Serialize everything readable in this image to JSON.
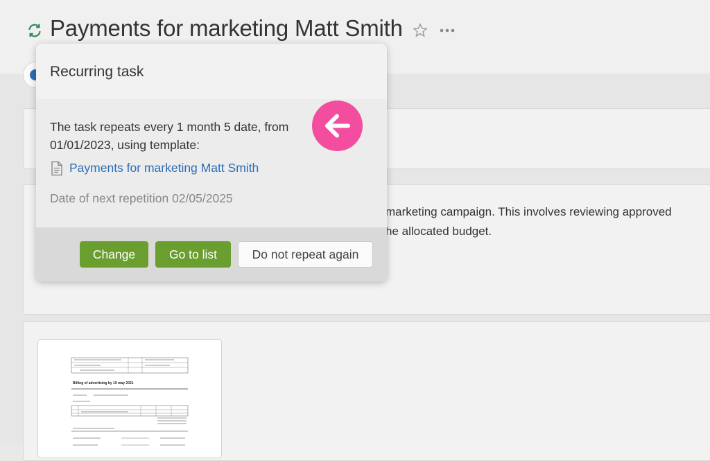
{
  "header": {
    "title": "Payments for marketing Matt Smith",
    "icons": {
      "recurring": "recurring-icon",
      "favorite": "star-icon",
      "more": "more-icon"
    }
  },
  "description": {
    "line1": "marketing campaign. This involves reviewing approved",
    "line2": "he allocated budget."
  },
  "attachment": {
    "doc_title": "Billing of advertising by 19 may 2021"
  },
  "popover": {
    "title": "Recurring task",
    "text": "The task repeats every 1 month 5 date, from 01/01/2023, using template:",
    "template_link": "Payments for marketing Matt Smith",
    "next_repetition": "Date of next repetition 02/05/2025",
    "buttons": {
      "change": "Change",
      "go_to_list": "Go to list",
      "do_not_repeat": "Do not repeat again"
    }
  },
  "colors": {
    "accent_green": "#6a9e2e",
    "link_blue": "#2d6db5",
    "status_blue": "#2d6db5",
    "annotation_pink": "#f24d9e"
  }
}
